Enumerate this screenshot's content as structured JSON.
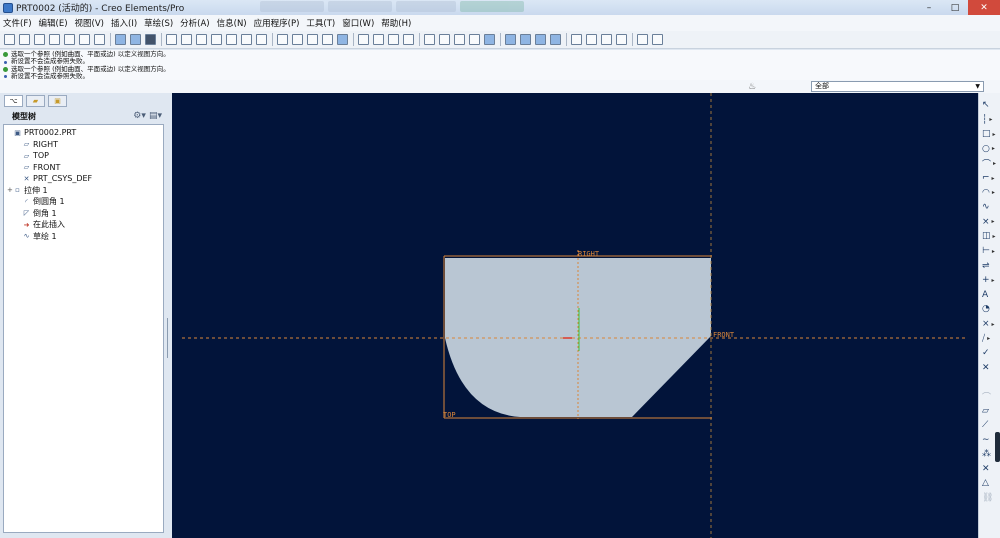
{
  "window": {
    "title": "PRT0002 (活动的) - Creo Elements/Pro",
    "minimize": "–",
    "maximize": "□",
    "close": "✕"
  },
  "menu": [
    "文件(F)",
    "编辑(E)",
    "视图(V)",
    "插入(I)",
    "草绘(S)",
    "分析(A)",
    "信息(N)",
    "应用程序(P)",
    "工具(T)",
    "窗口(W)",
    "帮助(H)"
  ],
  "messages": [
    {
      "type": "prompt",
      "text": "选取一个参照 (例如曲面、平面或边) 以定义视图方向。"
    },
    {
      "type": "info",
      "text": "新设置不会造成参照失败。"
    },
    {
      "type": "prompt",
      "text": "选取一个参照 (例如曲面、平面或边) 以定义视图方向。"
    },
    {
      "type": "info",
      "text": "新设置不会造成参照失败。"
    }
  ],
  "filter": {
    "value": "全部"
  },
  "sidebar": {
    "tree_title": "模型树",
    "items": [
      {
        "label": "PRT0002.PRT",
        "icon": "part-icon",
        "glyph": "▣",
        "indent": 0,
        "expand": ""
      },
      {
        "label": "RIGHT",
        "icon": "datum-plane-icon",
        "glyph": "▱",
        "indent": 1,
        "expand": ""
      },
      {
        "label": "TOP",
        "icon": "datum-plane-icon",
        "glyph": "▱",
        "indent": 1,
        "expand": ""
      },
      {
        "label": "FRONT",
        "icon": "datum-plane-icon",
        "glyph": "▱",
        "indent": 1,
        "expand": ""
      },
      {
        "label": "PRT_CSYS_DEF",
        "icon": "coordinate-system-icon",
        "glyph": "✕",
        "indent": 1,
        "expand": ""
      },
      {
        "label": "拉伸 1",
        "icon": "extrude-icon",
        "glyph": "▫",
        "indent": 0,
        "expand": "+"
      },
      {
        "label": "倒圆角 1",
        "icon": "round-icon",
        "glyph": "◜",
        "indent": 1,
        "expand": ""
      },
      {
        "label": "倒角 1",
        "icon": "chamfer-icon",
        "glyph": "◸",
        "indent": 1,
        "expand": ""
      },
      {
        "label": "在此插入",
        "icon": "insert-here-icon",
        "glyph": "➜",
        "indent": 1,
        "expand": ""
      },
      {
        "label": "草绘 1",
        "icon": "sketch-icon",
        "glyph": "∿",
        "indent": 1,
        "expand": ""
      }
    ]
  },
  "canvas": {
    "datum_labels": {
      "right": "RIGHT",
      "front": "FRONT",
      "top": "TOP"
    },
    "colors": {
      "background": "#02143a",
      "part": "#b9c6d3",
      "datum": "#d9863a",
      "axis_green": "#3cc43c"
    }
  },
  "right_tools": [
    {
      "icon": "select-arrow-icon",
      "glyph": "↖",
      "more": false,
      "dim": false
    },
    {
      "icon": "centerline-icon",
      "glyph": "┆",
      "more": true,
      "dim": false
    },
    {
      "icon": "rectangle-icon",
      "glyph": "□",
      "more": true,
      "dim": false
    },
    {
      "icon": "circle-icon",
      "glyph": "○",
      "more": true,
      "dim": false
    },
    {
      "icon": "arc-icon",
      "glyph": "⌒",
      "more": true,
      "dim": false
    },
    {
      "icon": "fillet-icon",
      "glyph": "⌐",
      "more": true,
      "dim": false
    },
    {
      "icon": "ellipse-arc-icon",
      "glyph": "◠",
      "more": true,
      "dim": false
    },
    {
      "icon": "spline-icon",
      "glyph": "∿",
      "more": false,
      "dim": false
    },
    {
      "icon": "point-icon",
      "glyph": "×",
      "more": true,
      "dim": false
    },
    {
      "icon": "offset-icon",
      "glyph": "◫",
      "more": true,
      "dim": false
    },
    {
      "icon": "dimension-icon",
      "glyph": "⊢",
      "more": true,
      "dim": false
    },
    {
      "icon": "modify-icon",
      "glyph": "⇌",
      "more": false,
      "dim": false
    },
    {
      "icon": "constraint-icon",
      "glyph": "+",
      "more": true,
      "dim": false
    },
    {
      "icon": "text-icon",
      "glyph": "A",
      "more": false,
      "dim": false
    },
    {
      "icon": "palette-icon",
      "glyph": "◔",
      "more": false,
      "dim": false
    },
    {
      "icon": "trim-icon",
      "glyph": "⨯",
      "more": true,
      "dim": false
    },
    {
      "icon": "mirror-icon",
      "glyph": "⧸",
      "more": true,
      "dim": false
    },
    {
      "icon": "accept-check-icon",
      "glyph": "✓",
      "more": false,
      "dim": false
    },
    {
      "icon": "cancel-x-icon",
      "glyph": "✕",
      "more": false,
      "dim": false
    }
  ],
  "right_tools_lower": [
    {
      "icon": "arc-tool-icon",
      "glyph": "⌒",
      "dim": true
    },
    {
      "icon": "parallelogram-icon",
      "glyph": "▱",
      "dim": false
    },
    {
      "icon": "line-tool-icon",
      "glyph": "⟋",
      "dim": false
    },
    {
      "icon": "curve-tool-icon",
      "glyph": "∼",
      "dim": false
    },
    {
      "icon": "node-tool-icon",
      "glyph": "⁂",
      "dim": false
    },
    {
      "icon": "cross-tool-icon",
      "glyph": "✕",
      "dim": false
    },
    {
      "icon": "warning-tool-icon",
      "glyph": "△",
      "dim": false
    },
    {
      "icon": "chain-tool-icon",
      "glyph": "⛓",
      "dim": true
    }
  ]
}
